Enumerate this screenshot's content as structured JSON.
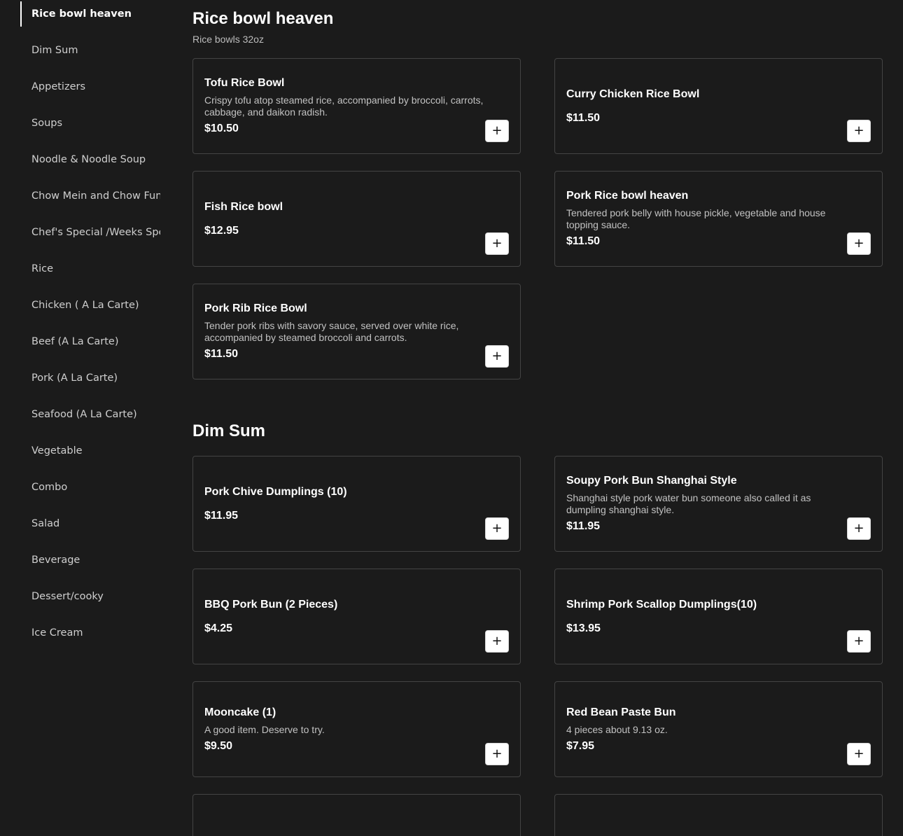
{
  "sidebar": {
    "items": [
      {
        "label": "Rice bowl heaven",
        "active": true
      },
      {
        "label": "Dim Sum"
      },
      {
        "label": "Appetizers"
      },
      {
        "label": "Soups"
      },
      {
        "label": "Noodle & Noodle Soup"
      },
      {
        "label": "Chow Mein and Chow Fun"
      },
      {
        "label": "Chef's Special /Weeks Spe"
      },
      {
        "label": "Rice"
      },
      {
        "label": "Chicken ( A La Carte)"
      },
      {
        "label": "Beef (A La Carte)"
      },
      {
        "label": "Pork (A La Carte)"
      },
      {
        "label": "Seafood (A La Carte)"
      },
      {
        "label": "Vegetable"
      },
      {
        "label": "Combo"
      },
      {
        "label": "Salad"
      },
      {
        "label": "Beverage"
      },
      {
        "label": "Dessert/cooky"
      },
      {
        "label": "Ice Cream"
      }
    ]
  },
  "sections": {
    "rice": {
      "title": "Rice bowl heaven",
      "subtitle": "Rice bowls 32oz",
      "items": [
        {
          "name": "Tofu Rice Bowl",
          "desc": "Crispy tofu atop steamed rice, accompanied by broccoli, carrots, cabbage, and daikon radish.",
          "price": "$10.50"
        },
        {
          "name": "Curry Chicken Rice Bowl",
          "price": "$11.50"
        },
        {
          "name": "Fish Rice bowl",
          "price": "$12.95"
        },
        {
          "name": "Pork Rice bowl heaven",
          "desc": "Tendered pork belly with house pickle, vegetable and house topping sauce.",
          "price": "$11.50"
        },
        {
          "name": "Pork Rib Rice Bowl",
          "desc": "Tender pork ribs with savory sauce, served over white rice, accompanied by steamed broccoli and carrots.",
          "price": "$11.50"
        }
      ]
    },
    "dimsum": {
      "title": "Dim Sum",
      "items": [
        {
          "name": "Pork Chive Dumplings (10)",
          "price": "$11.95"
        },
        {
          "name": "Soupy Pork Bun Shanghai Style",
          "desc": "Shanghai style pork water bun someone also called it as dumpling shanghai style.",
          "price": "$11.95"
        },
        {
          "name": "BBQ Pork Bun (2 Pieces)",
          "price": "$4.25"
        },
        {
          "name": "Shrimp Pork Scallop Dumplings(10)",
          "price": "$13.95"
        },
        {
          "name": "Mooncake (1)",
          "desc": "A good item. Deserve to try.",
          "price": "$9.50"
        },
        {
          "name": "Red Bean Paste Bun",
          "desc": "4 pieces about 9.13 oz.",
          "price": "$7.95"
        }
      ]
    }
  },
  "add_button": {
    "label": "+",
    "icon": "plus-icon"
  }
}
